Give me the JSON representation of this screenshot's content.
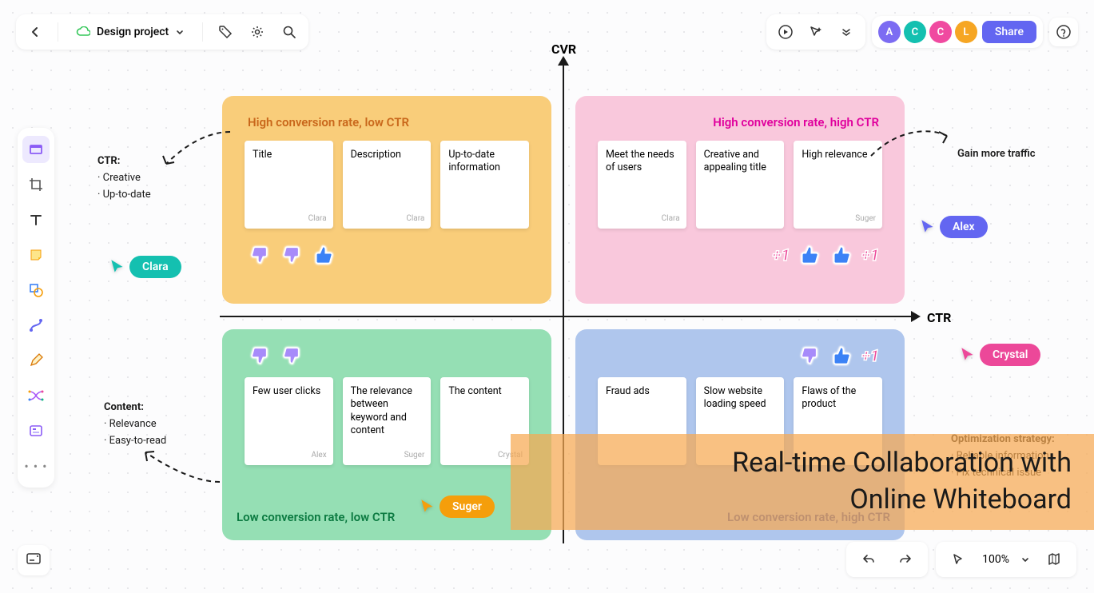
{
  "project_title": "Design project",
  "axes": {
    "y": "CVR",
    "x": "CTR"
  },
  "collaborators": [
    {
      "initial": "A",
      "color": "#7c6cf2"
    },
    {
      "initial": "C",
      "color": "#14c0b0"
    },
    {
      "initial": "C",
      "color": "#f04aa0"
    },
    {
      "initial": "L",
      "color": "#f6a623"
    }
  ],
  "share_label": "Share",
  "zoom": "100%",
  "quadrants": {
    "top_left": {
      "title": "High conversion rate, low CTR",
      "notes": [
        {
          "text": "Title",
          "author": "Clara"
        },
        {
          "text": "Description",
          "author": "Clara"
        },
        {
          "text": "Up-to-date information",
          "author": ""
        }
      ]
    },
    "top_right": {
      "title": "High conversion rate, high CTR",
      "notes": [
        {
          "text": "Meet the needs of users",
          "author": "Clara"
        },
        {
          "text": "Creative and appealing title",
          "author": ""
        },
        {
          "text": "High relevance",
          "author": "Suger"
        }
      ]
    },
    "bottom_left": {
      "title": "Low conversion rate, low CTR",
      "notes": [
        {
          "text": "Few user clicks",
          "author": "Alex"
        },
        {
          "text": "The relevance between keyword and content",
          "author": "Suger"
        },
        {
          "text": "The content",
          "author": "Crystal"
        }
      ]
    },
    "bottom_right": {
      "title": "Low conversion rate, high CTR",
      "notes": [
        {
          "text": "Fraud ads",
          "author": ""
        },
        {
          "text": "Slow website loading speed",
          "author": ""
        },
        {
          "text": "Flaws of the product",
          "author": ""
        }
      ]
    }
  },
  "side_notes": {
    "ctr": {
      "heading": "CTR:",
      "items": [
        "Creative",
        "Up-to-date"
      ]
    },
    "content": {
      "heading": "Content:",
      "items": [
        "Relevance",
        "Easy-to-read"
      ]
    },
    "traffic": "Gain more traffic",
    "optimization": {
      "heading": "Optimization strategy:",
      "items": [
        "Reliable information",
        "Fix technical issue"
      ]
    }
  },
  "cursors": {
    "clara": {
      "name": "Clara",
      "color": "#14c0b0"
    },
    "alex": {
      "name": "Alex",
      "color": "#6366f1"
    },
    "suger": {
      "name": "Suger",
      "color": "#f59e0b"
    },
    "crystal": {
      "name": "Crystal",
      "color": "#ec4899"
    }
  },
  "banner_line1": "Real-time Collaboration with",
  "banner_line2": "Online Whiteboard",
  "plus1": "+1"
}
